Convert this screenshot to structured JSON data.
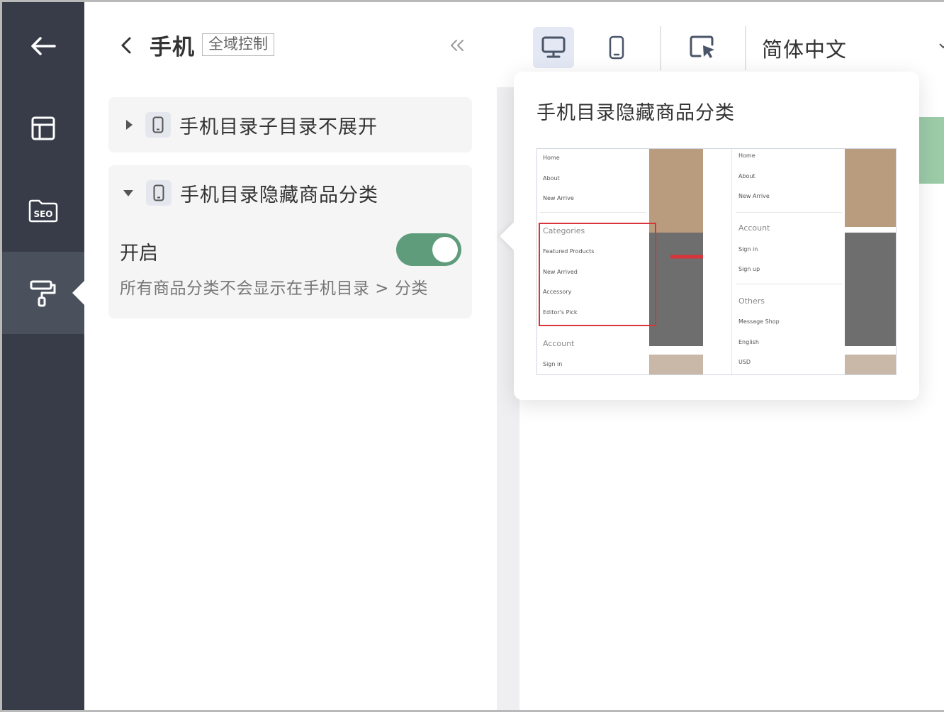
{
  "rail": {
    "items": [
      {
        "name": "back",
        "icon": "arrow-left-icon"
      },
      {
        "name": "layout",
        "icon": "layout-icon"
      },
      {
        "name": "seo",
        "icon": "seo-folder-icon",
        "label": "SEO"
      },
      {
        "name": "theme",
        "icon": "paint-roller-icon",
        "active": true
      }
    ]
  },
  "panel": {
    "title": "手机",
    "tag": "全域控制",
    "sections": [
      {
        "label": "手机目录子目录不展开",
        "expanded": false
      },
      {
        "label": "手机目录隐藏商品分类",
        "expanded": true,
        "toggle_label": "开启",
        "toggle_on": true,
        "description": "所有商品分类不会显示在手机目录 > 分类"
      }
    ]
  },
  "toolbar": {
    "language": "简体中文"
  },
  "popover": {
    "title": "手机目录隐藏商品分类",
    "preview": {
      "left_menu": [
        "Home",
        "About",
        "New Arrive"
      ],
      "left_categories_header": "Categories",
      "left_categories": [
        "Featured Products",
        "New Arrived",
        "Accessory",
        "Editor's Pick"
      ],
      "left_account_header": "Account",
      "left_account": [
        "Sign in"
      ],
      "right_menu": [
        "Home",
        "About",
        "New Arrive"
      ],
      "right_account_header": "Account",
      "right_account": [
        "Sign in",
        "Sign up"
      ],
      "right_others_header": "Others",
      "right_others": [
        "Message Shop",
        "English",
        "USD"
      ]
    }
  },
  "colors": {
    "rail_bg": "#373c48",
    "toggle_on": "#5e9c7c",
    "highlight_red": "#d9343a"
  }
}
